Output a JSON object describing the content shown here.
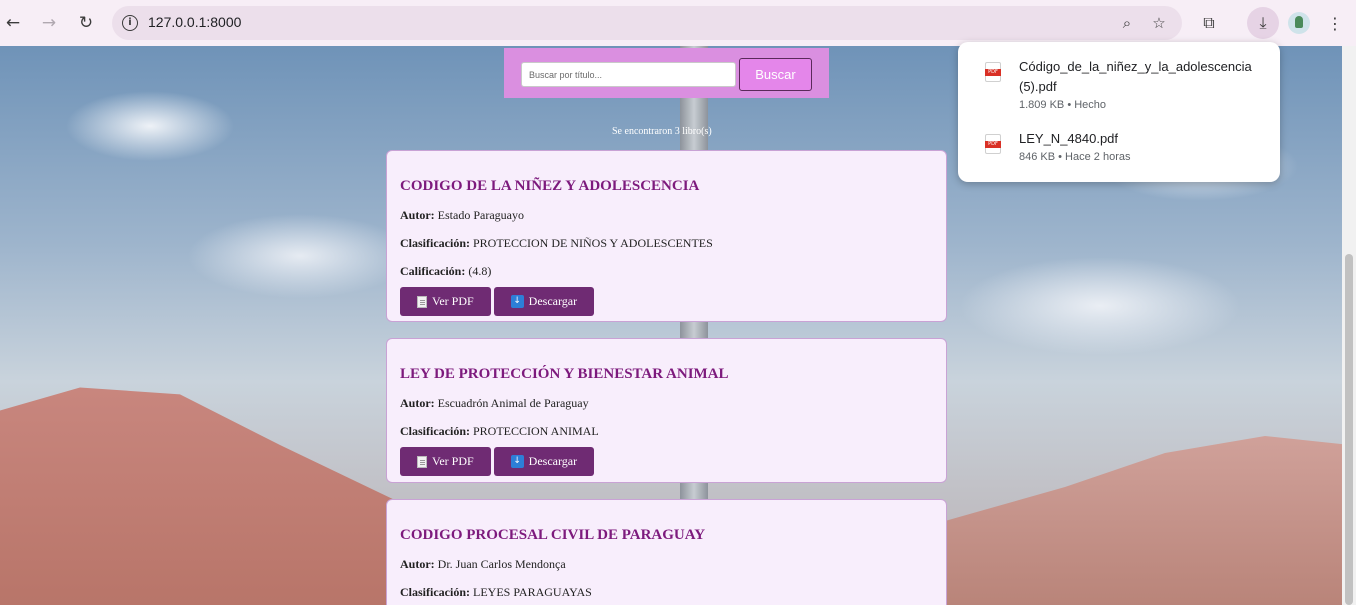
{
  "browser": {
    "url": "127.0.0.1:8000"
  },
  "search": {
    "placeholder": "Buscar por título...",
    "button_label": "Buscar"
  },
  "result_count": "Se encontraron 3 libro(s)",
  "labels": {
    "autor": "Autor:",
    "clasificacion": "Clasificación:",
    "calificacion": "Calificación:",
    "ver_pdf": "Ver PDF",
    "descargar": "Descargar"
  },
  "books": [
    {
      "title": "CODIGO DE LA NIÑEZ Y ADOLESCENCIA",
      "author": "Estado Paraguayo",
      "classification": "PROTECCION DE NIÑOS Y ADOLESCENTES",
      "rating": "(4.8)"
    },
    {
      "title": "LEY DE PROTECCIÓN Y BIENESTAR ANIMAL",
      "author": "Escuadrón Animal de Paraguay",
      "classification": "PROTECCION ANIMAL"
    },
    {
      "title": "CODIGO PROCESAL CIVIL DE PARAGUAY",
      "author": "Dr. Juan Carlos Mendonça",
      "classification": "LEYES PARAGUAYAS"
    }
  ],
  "downloads": [
    {
      "name": "Código_de_la_niñez_y_la_adolescencia (5).pdf",
      "meta": "1.809 KB • Hecho"
    },
    {
      "name": "LEY_N_4840.pdf",
      "meta": "846 KB • Hace 2 horas"
    }
  ],
  "icons": {
    "back": "arrow-left-icon",
    "forward": "arrow-right-icon",
    "reload": "reload-icon",
    "info": "info-icon",
    "zoom": "zoom-icon",
    "bookmark": "star-icon",
    "extensions": "puzzle-icon",
    "downloads": "download-icon",
    "menu": "kebab-menu-icon"
  },
  "colors": {
    "accent": "#6f2b73",
    "title": "#7d1a7d",
    "search_panel": "#da8fe0"
  }
}
